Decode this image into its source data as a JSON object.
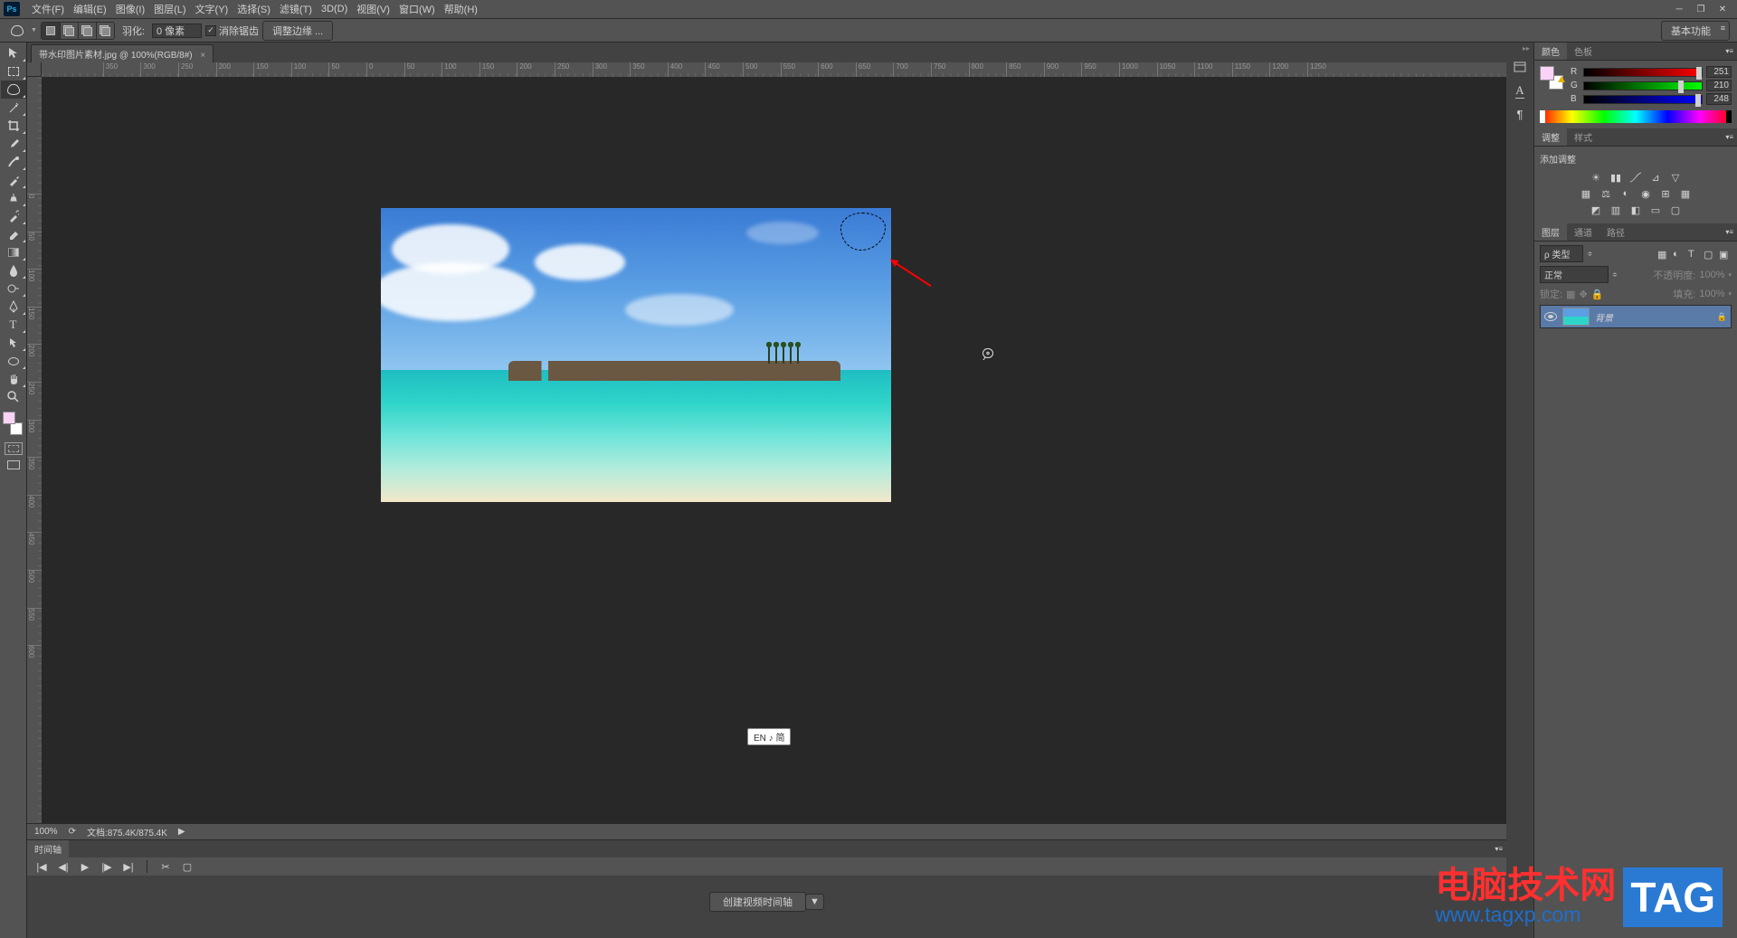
{
  "app_icon_text": "Ps",
  "menu": {
    "file": "文件(F)",
    "edit": "编辑(E)",
    "image": "图像(I)",
    "layer": "图层(L)",
    "type": "文字(Y)",
    "select": "选择(S)",
    "filter": "滤镜(T)",
    "threeD": "3D(D)",
    "view": "视图(V)",
    "window": "窗口(W)",
    "help": "帮助(H)"
  },
  "options": {
    "feather_label": "羽化:",
    "feather_value": "0 像素",
    "antialias_label": "消除锯齿",
    "refine_edge": "调整边缘 ...",
    "workspace": "基本功能"
  },
  "document": {
    "tab_title": "带水印图片素材.jpg @ 100%(RGB/8#)",
    "zoom": "100%",
    "doc_size_label": "文档:875.4K/875.4K"
  },
  "ruler_h": [
    "0",
    "50",
    "100",
    "150",
    "200",
    "250",
    "300",
    "350",
    "400",
    "450",
    "500",
    "550",
    "600",
    "650",
    "700",
    "750",
    "800",
    "850",
    "900",
    "950",
    "1000",
    "1050",
    "1100",
    "1150",
    "1200",
    "1250"
  ],
  "ruler_h_neg": [
    "50",
    "100",
    "150",
    "200",
    "250",
    "300",
    "350"
  ],
  "ruler_v": [
    "0",
    "50",
    "100",
    "150",
    "200",
    "250",
    "300",
    "350",
    "400",
    "450",
    "500",
    "550",
    "600"
  ],
  "timeline": {
    "tab": "时间轴",
    "create_button": "创建视频时间轴"
  },
  "color_panel": {
    "tab_color": "颜色",
    "tab_swatches": "色板",
    "r_label": "R",
    "g_label": "G",
    "b_label": "B",
    "r_value": "251",
    "g_value": "210",
    "b_value": "248"
  },
  "adjust_panel": {
    "tab_adjust": "调整",
    "tab_styles": "样式",
    "add_label": "添加调整"
  },
  "layers_panel": {
    "tab_layers": "图层",
    "tab_channels": "通道",
    "tab_paths": "路径",
    "filter_kind": "ρ 类型",
    "blend_mode": "正常",
    "opacity_label": "不透明度:",
    "opacity_value": "100%",
    "lock_label": "锁定:",
    "fill_label": "填充:",
    "fill_value": "100%",
    "layer_name": "背景"
  },
  "ime": "EN ♪ 简",
  "watermark": {
    "cn": "电脑技术网",
    "url": "www.tagxp.com",
    "tag": "TAG"
  }
}
